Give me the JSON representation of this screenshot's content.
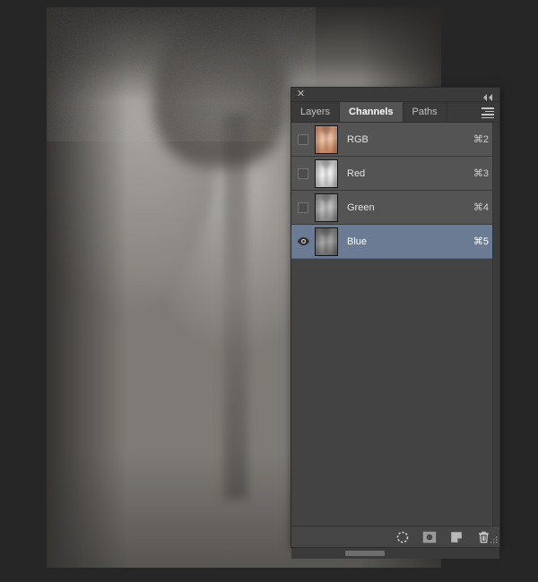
{
  "window": {
    "close_label": "✕",
    "collapse_icon": "double-chevron-left-icon",
    "menu_icon": "panel-menu-icon"
  },
  "tabs": [
    {
      "label": "Layers",
      "active": false
    },
    {
      "label": "Channels",
      "active": true
    },
    {
      "label": "Paths",
      "active": false
    }
  ],
  "channels": [
    {
      "name": "RGB",
      "shortcut": "⌘2",
      "visible": false,
      "selected": false,
      "thumb": "rgb-thumbnail"
    },
    {
      "name": "Red",
      "shortcut": "⌘3",
      "visible": false,
      "selected": false,
      "thumb": "red-channel-thumbnail"
    },
    {
      "name": "Green",
      "shortcut": "⌘4",
      "visible": false,
      "selected": false,
      "thumb": "green-channel-thumbnail"
    },
    {
      "name": "Blue",
      "shortcut": "⌘5",
      "visible": true,
      "selected": true,
      "thumb": "blue-channel-thumbnail"
    }
  ],
  "footer_buttons": [
    {
      "name": "load-channel-as-selection-button",
      "icon": "dashed-circle-icon"
    },
    {
      "name": "save-selection-as-channel-button",
      "icon": "mask-icon"
    },
    {
      "name": "create-new-channel-button",
      "icon": "new-page-icon"
    },
    {
      "name": "delete-channel-button",
      "icon": "trash-icon"
    }
  ],
  "colors": {
    "panel_bg": "#434343",
    "row_bg": "#545454",
    "row_selected": "#6b7b94",
    "tab_active_bg": "#545454",
    "titlebar_bg": "#3a3a3a",
    "app_bg": "#262626",
    "text": "#e3e3e3"
  },
  "canvas": {
    "image_description": "grayscale-photo-of-back-and-neck"
  }
}
